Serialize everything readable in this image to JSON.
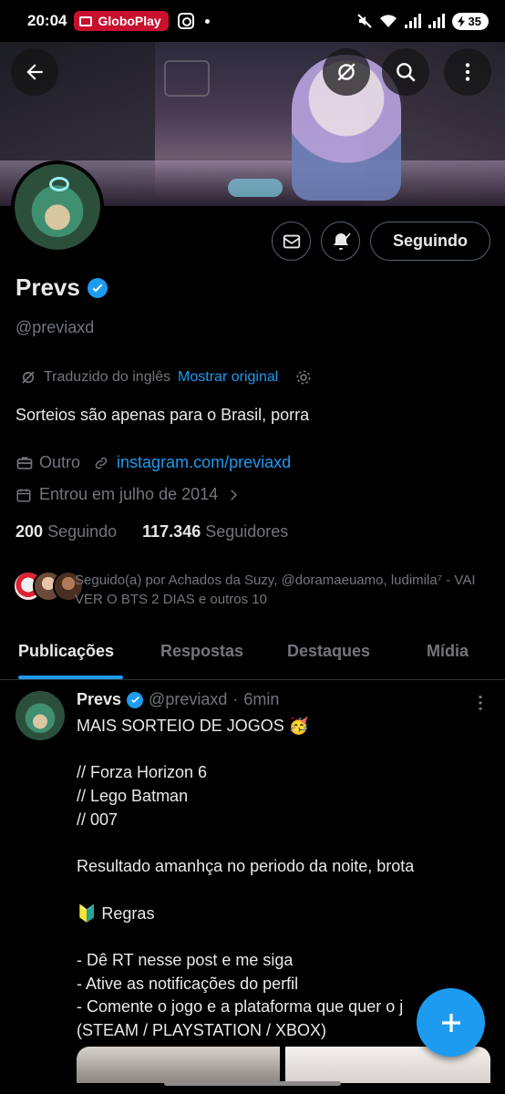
{
  "status_bar": {
    "time": "20:04",
    "app_chip": "GloboPlay",
    "battery": "35"
  },
  "profile": {
    "name": "Prevs",
    "handle": "@previaxd",
    "verified": true,
    "follow_button": "Seguindo",
    "translation": {
      "label": "Traduzido do inglês",
      "show_original": "Mostrar original"
    },
    "bio": "Sorteios são apenas para o Brasil, porra",
    "category": "Outro",
    "link": "instagram.com/previaxd",
    "joined": "Entrou em julho de 2014",
    "following_count": "200",
    "following_label": "Seguindo",
    "followers_count": "117.346",
    "followers_label": "Seguidores",
    "followed_by": "Seguido(a) por Achados da Suzy, @doramaeuamo, ludimila⁷ - VAI VER O BTS 2 DIAS e outros 10"
  },
  "tabs": [
    "Publicações",
    "Respostas",
    "Destaques",
    "Mídia"
  ],
  "active_tab": 0,
  "tweet": {
    "author": "Prevs",
    "handle": "@previaxd",
    "time": "6min",
    "text": "MAIS SORTEIO DE JOGOS 🥳\n\n// Forza Horizon 6\n// Lego Batman\n// 007\n\nResultado amanhça no periodo da noite, brota\n\n🔰 Regras\n\n- Dê RT nesse post e me siga\n- Ative as notificações do perfil\n- Comente o jogo e a plataforma que quer o j\n(STEAM / PLAYSTATION / XBOX)"
  },
  "colors": {
    "accent": "#1d9bf0",
    "background": "#000000",
    "muted_text": "#71767b",
    "primary_text": "#e7e9ea"
  }
}
